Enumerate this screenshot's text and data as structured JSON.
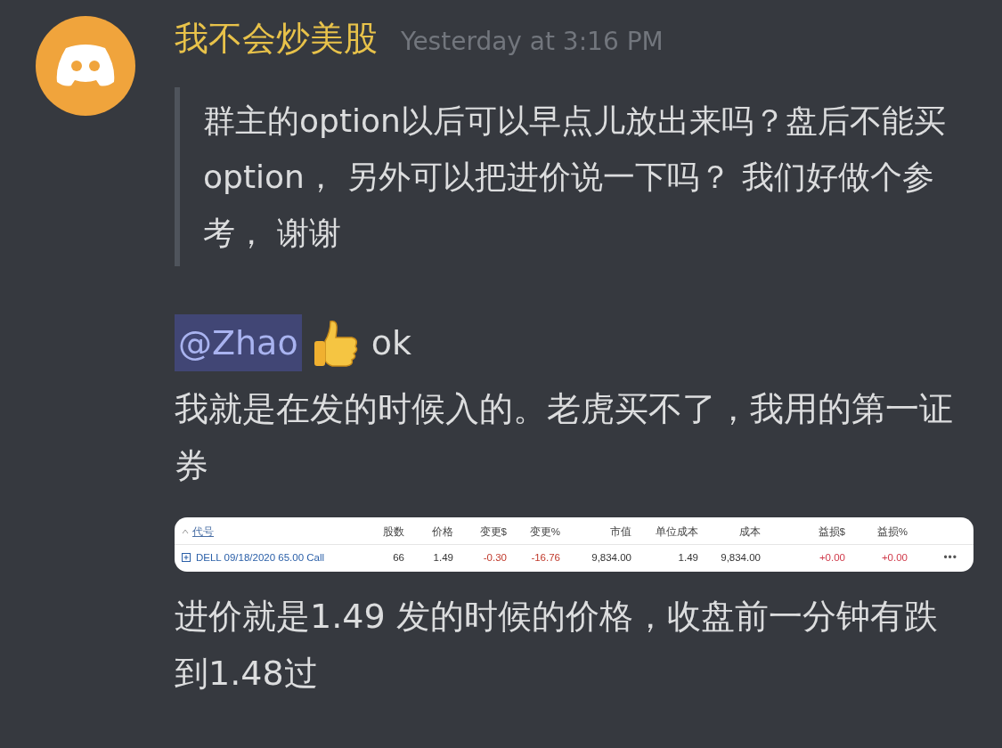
{
  "message": {
    "author": "我不会炒美股",
    "timestamp": "Yesterday at 3:16 PM",
    "quote": "群主的option以后可以早点儿放出来吗？盘后不能买option， 另外可以把进价说一下吗？ 我们好做个参考， 谢谢",
    "mention": "@Zhao",
    "reply": "ok",
    "text": "我就是在发的时候入的。老虎买不了，我用的第一证券",
    "table": {
      "columns": [
        "代号",
        "股数",
        "价格",
        "变更$",
        "变更%",
        "市值",
        "单位成本",
        "成本",
        "益损$",
        "益损%"
      ],
      "rows": [
        {
          "cells": [
            {
              "text": "DELL 09/18/2020 65.00 Call",
              "kind": "symbol"
            },
            {
              "text": "66"
            },
            {
              "text": "1.49"
            },
            {
              "text": "-0.30",
              "color": "#c0392b"
            },
            {
              "text": "-16.76",
              "color": "#c0392b"
            },
            {
              "text": "9,834.00"
            },
            {
              "text": "1.49"
            },
            {
              "text": "9,834.00"
            },
            {
              "text": "+0.00",
              "color": "#d03a4a"
            },
            {
              "text": "+0.00",
              "color": "#d03a4a"
            }
          ],
          "more": "•••"
        }
      ]
    },
    "closing": "进价就是1.49 发的时候的价格，收盘前一分钟有跌到1.48过"
  }
}
